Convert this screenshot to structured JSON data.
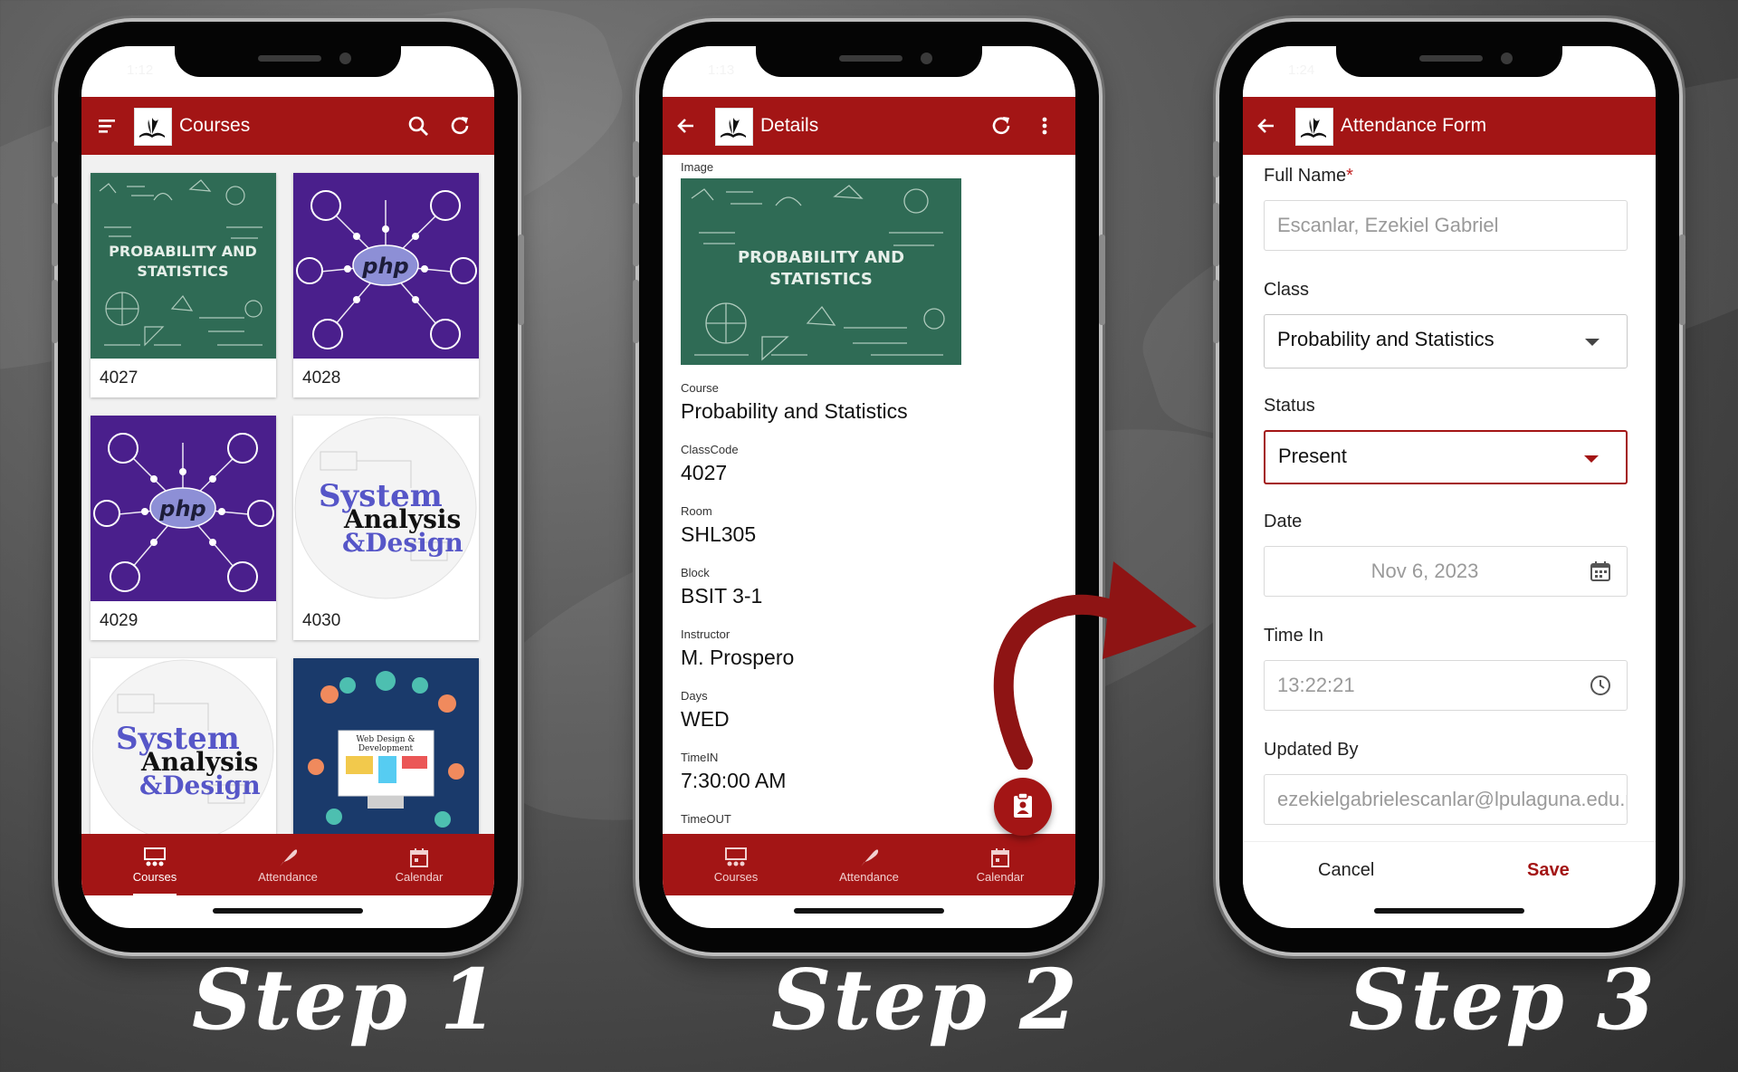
{
  "phone1": {
    "status_time": "1:12",
    "appbar_title": "Courses",
    "menu_icon": "menu-icon",
    "search_icon": "search-icon",
    "refresh_icon": "refresh-icon",
    "courses": [
      {
        "code": "4027",
        "image": "probability-and-statistics",
        "image_text": [
          "PROBABILITY AND",
          "STATISTICS"
        ]
      },
      {
        "code": "4028",
        "image": "php",
        "image_text": [
          "php"
        ]
      },
      {
        "code": "4029",
        "image": "php",
        "image_text": [
          "php"
        ]
      },
      {
        "code": "4030",
        "image": "system-analysis-design",
        "image_text": [
          "System",
          "Analysis",
          "&Design"
        ]
      },
      {
        "code": "",
        "image": "system-analysis-design",
        "image_text": [
          "System",
          "Analysis",
          "&Design"
        ]
      },
      {
        "code": "",
        "image": "web-design-development",
        "image_text": [
          "Web Design &",
          "Development"
        ]
      }
    ]
  },
  "phone2": {
    "status_time": "1:13",
    "appbar_title": "Details",
    "back_icon": "back-arrow-icon",
    "refresh_icon": "refresh-icon",
    "more_icon": "more-vert-icon",
    "image_label": "Image",
    "image_text": [
      "PROBABILITY AND",
      "STATISTICS"
    ],
    "fields": [
      {
        "label": "Course",
        "value": "Probability and Statistics"
      },
      {
        "label": "ClassCode",
        "value": "4027"
      },
      {
        "label": "Room",
        "value": "SHL305"
      },
      {
        "label": "Block",
        "value": "BSIT 3-1"
      },
      {
        "label": "Instructor",
        "value": "M. Prospero"
      },
      {
        "label": "Days",
        "value": "WED"
      },
      {
        "label": "TimeIN",
        "value": "7:30:00 AM"
      },
      {
        "label": "TimeOUT",
        "value": ""
      }
    ],
    "fab_icon": "clipboard-person-icon"
  },
  "phone3": {
    "status_time": "1:24",
    "appbar_title": "Attendance Form",
    "back_icon": "back-arrow-icon",
    "full_name_label": "Full Name",
    "required_mark": "*",
    "full_name_value": "Escanlar, Ezekiel Gabriel",
    "class_label": "Class",
    "class_value": "Probability and Statistics",
    "status_label": "Status",
    "status_value": "Present",
    "date_label": "Date",
    "date_value": "Nov 6, 2023",
    "time_in_label": "Time In",
    "time_in_value": "13:22:21",
    "updated_by_label": "Updated By",
    "updated_by_value": "ezekielgabrielescanlar@lpulaguna.edu.ph",
    "cancel_label": "Cancel",
    "save_label": "Save"
  },
  "nav": {
    "courses": "Courses",
    "attendance": "Attendance",
    "calendar": "Calendar"
  },
  "steps": [
    "Step 1",
    "Step 2",
    "Step 3"
  ],
  "colors": {
    "accent": "#a31515",
    "chalkboard": "#2f6b55",
    "php_purple": "#4a1f8c",
    "web_navy": "#1a3a6b"
  }
}
